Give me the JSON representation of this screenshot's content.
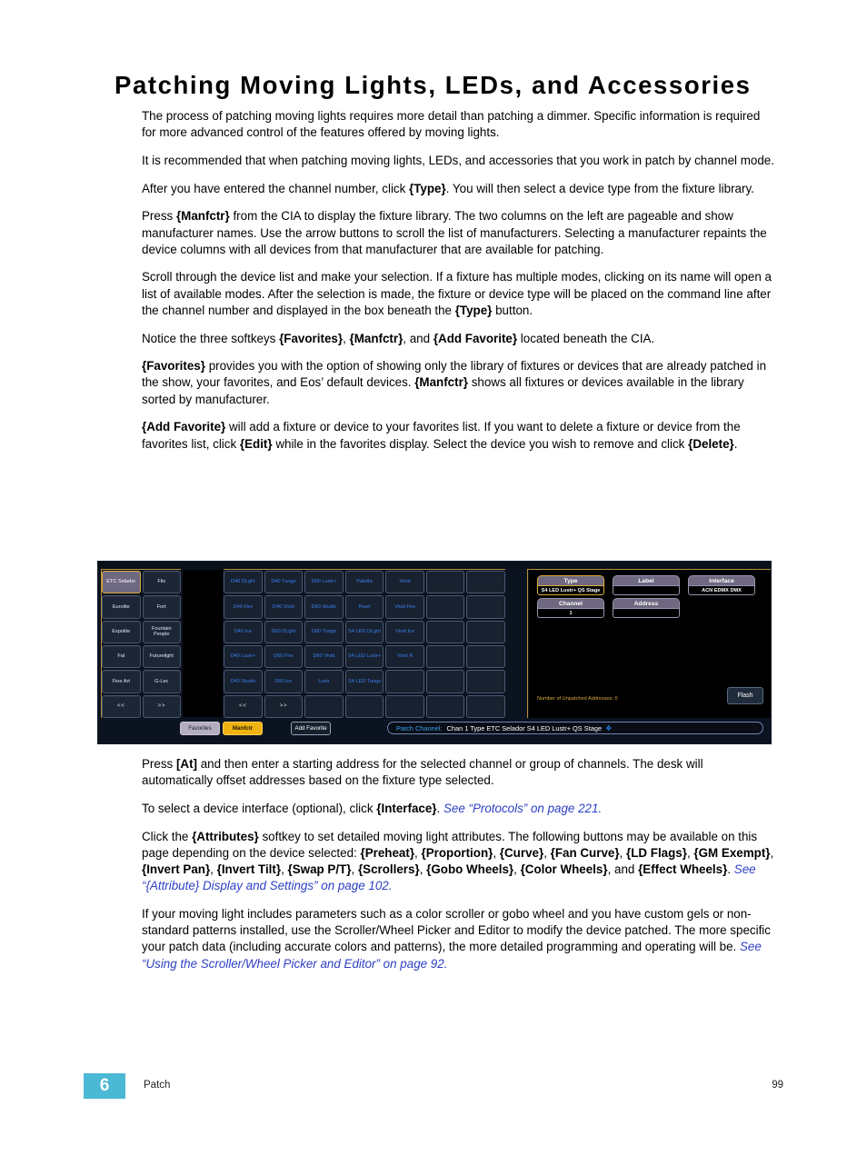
{
  "document": {
    "title": "Patching Moving Lights, LEDs, and Accessories",
    "paragraphs_top": [
      "The process of patching moving lights requires more detail than patching a dimmer. Specific information is required for more advanced control of the features offered by moving lights.",
      "It is recommended that when patching moving lights, LEDs, and accessories that you work in patch by channel mode.",
      "After you have entered the channel number, click {Type}. You will then select a device type from the fixture library.",
      "Press {Manfctr} from the CIA to display the fixture library. The two columns on the left are pageable and show manufacturer names. Use the arrow buttons to scroll the list of manufacturers. Selecting a manufacturer repaints the device columns with all devices from that manufacturer that are available for patching.",
      "Scroll through the device list and make your selection. If a fixture has multiple modes, clicking on its name will open a list of available modes. After the selection is made, the fixture or device type will be placed on the command line after the channel number and displayed in the box beneath the {Type} button.",
      "Notice the three softkeys {Favorites}, {Manfctr}, and {Add Favorite} located beneath the CIA.",
      "{Favorites} provides you with the option of showing only the library of fixtures or devices that are already patched in the show, your favorites, and Eos’ default devices. {Manfctr} shows all fixtures or devices available in the library sorted by manufacturer.",
      "{Add Favorite} will add a fixture or device to your favorites list. If you want to delete a fixture or device from the favorites list, click {Edit} while in the favorites display. Select the device you wish to remove and click {Delete}."
    ],
    "paragraphs_bottom": [
      "Press [At] and then enter a starting address for the selected channel or group of channels. The desk will automatically offset addresses based on the fixture type selected.",
      "To select a device interface (optional), click {Interface}. See “Protocols” on page 221.",
      "Click the {Attributes} softkey to set detailed moving light attributes. The following buttons may be available on this page depending on the device selected: {Preheat}, {Proportion}, {Curve}, {Fan Curve}, {LD Flags}, {GM Exempt}, {Invert Pan}, {Invert Tilt}, {Swap P/T}, {Scrollers}, {Gobo Wheels}, {Color Wheels}, and {Effect Wheels}. See “{Attribute} Display and Settings” on page 102.",
      "If your moving light includes parameters such as a color scroller or gobo wheel and you have custom gels or non-standard patterns installed, use the Scroller/Wheel Picker and Editor to modify the device patched. The more specific your patch data (including accurate colors and patterns), the more detailed programming and operating will be. See “Using the Scroller/Wheel Picker and Editor” on page 92."
    ]
  },
  "footer": {
    "chapter_number": "6",
    "chapter_label": "Patch",
    "page_number": "99",
    "accent_color": "#4bb8d4"
  },
  "console": {
    "manufacturers": [
      "ETC Selador",
      "Flix",
      "Eurolite",
      "Fort",
      "Expolite",
      "Fountain People",
      "Fal",
      "Futurelight",
      "Fine Art",
      "G-Lec",
      "<<",
      ">>"
    ],
    "manufacturer_selected": "ETC Selador",
    "devices": [
      "D40 DLght",
      "D40 Tungs",
      "D60 Lustr+",
      "Paletta",
      "Vivid",
      "",
      "",
      "D40 Fire",
      "D40 Vivid",
      "D60 Studio",
      "Pearl",
      "Vivid Fire",
      "",
      "",
      "D40 Ice",
      "D60 DLght",
      "D60 Tungs",
      "S4 LED DLght",
      "Vivid Ice",
      "",
      "",
      "D40 Lustr+",
      "D60 Fire",
      "D60 Vivid",
      "S4 LED Lustr+",
      "Vivid R",
      "",
      "",
      "D40 Studio",
      "D60 Ice",
      "Lustr",
      "S4 LED Tungs",
      "",
      "",
      "",
      "<<",
      ">>",
      "",
      "",
      "",
      "",
      ""
    ],
    "fields": {
      "type_label": "Type",
      "type_value": "S4 LED Lustr+ QS Stage",
      "label_label": "Label",
      "label_value": "",
      "interface_label": "Interface",
      "interface_value": "ACN EDMX DMX",
      "channel_label": "Channel",
      "channel_value": "1",
      "address_label": "Address",
      "address_value": ""
    },
    "unpatched_text": "Number of Unpatched Addresses: 0",
    "flash_button": "Flash",
    "softkeys": {
      "favorites": "Favorites",
      "manfctr": "Manfctr",
      "add_favorite": "Add Favorite"
    },
    "command_line": {
      "prefix": "Patch Channel:",
      "text": "Chan 1 Type ETC Selador S4 LED Lustr+ QS Stage",
      "cursor": "❖"
    }
  }
}
